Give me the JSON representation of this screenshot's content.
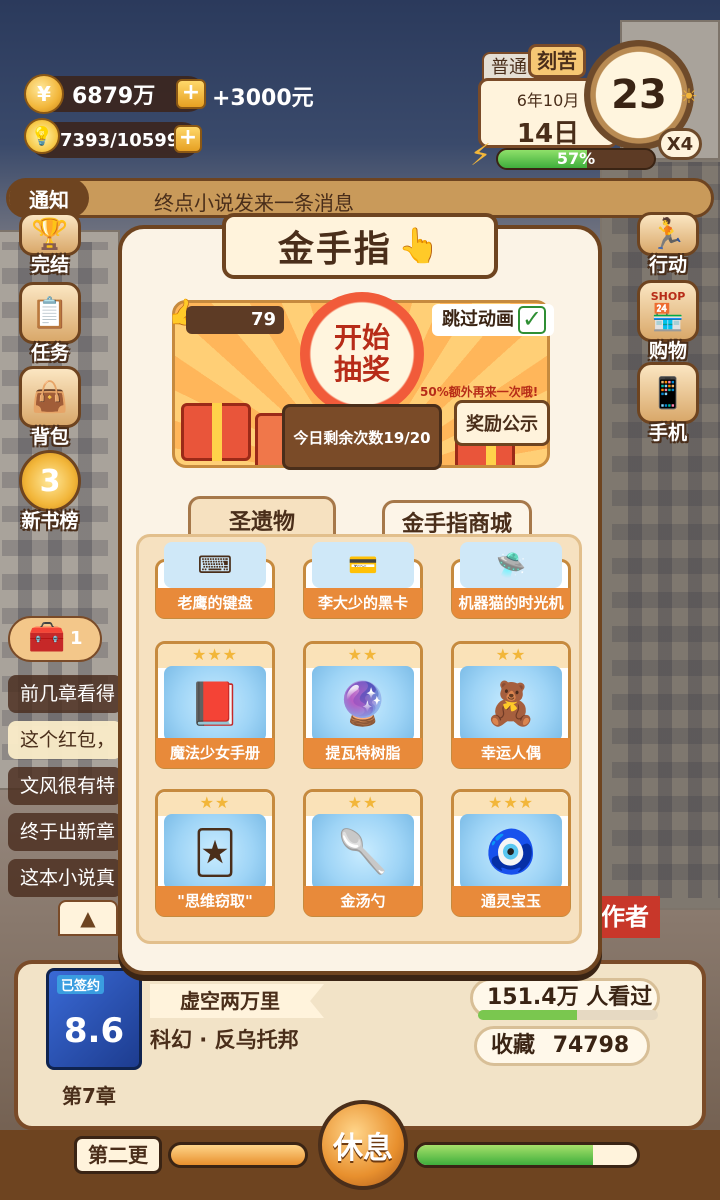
{
  "hud": {
    "money": "6879万",
    "money_bonus": "+3000元",
    "coin_symbol": "¥",
    "ideas": "7393/10599",
    "mode_normal": "普通",
    "mode_hard": "刻苦",
    "month": "6年10月",
    "day": "14日",
    "clock_value": "23",
    "speed": "X4",
    "energy_percent": "57%",
    "energy_fraction": 0.57
  },
  "notice": {
    "tag": "通知",
    "text": "终点小说发来一条消息"
  },
  "left_menu": [
    {
      "label": "完结",
      "icon": "trophy-icon"
    },
    {
      "label": "任务",
      "icon": "checklist-icon"
    },
    {
      "label": "背包",
      "icon": "bag-icon"
    },
    {
      "label": "新书榜",
      "icon": "medal-icon",
      "glyph": "3"
    }
  ],
  "right_menu": [
    {
      "label": "行动",
      "icon": "action-icon"
    },
    {
      "label": "购物",
      "icon": "shop-icon",
      "tag": "SHOP"
    },
    {
      "label": "手机",
      "icon": "phone-icon"
    }
  ],
  "treasure_count": "1",
  "chat_lines": [
    {
      "text": "前几章看得"
    },
    {
      "text": "这个红包，"
    },
    {
      "text": "文风很有特"
    },
    {
      "text": "终于出新章"
    },
    {
      "text": "这本小说真"
    }
  ],
  "author_tag": "作者",
  "modal": {
    "title": "金手指",
    "score": "79",
    "draw_button": "开始抽奖",
    "skip_label": "跳过动画",
    "skip_checked": true,
    "bonus_note": "50%额外再来一次哦!",
    "remaining": "今日剩余次数19/20",
    "reward_button": "奖励公示",
    "tabs": [
      {
        "label": "圣遗物",
        "active": true
      },
      {
        "label": "金手指商城",
        "active": false
      }
    ],
    "items_top": [
      {
        "label": "老鹰的键盘"
      },
      {
        "label": "李大少的黑卡"
      },
      {
        "label": "机器猫的时光机"
      }
    ],
    "items": [
      {
        "label": "魔法少女手册",
        "stars": "★★★",
        "icon": "book-icon",
        "glyph": "📕"
      },
      {
        "label": "提瓦特树脂",
        "stars": "★★",
        "icon": "resin-icon",
        "glyph": "🔮"
      },
      {
        "label": "幸运人偶",
        "stars": "★★",
        "icon": "doll-icon",
        "glyph": "🧸"
      },
      {
        "label": "\"思维窃取\"",
        "stars": "★★",
        "icon": "card-icon",
        "glyph": "🃏"
      },
      {
        "label": "金汤勺",
        "stars": "★★",
        "icon": "spoon-icon",
        "glyph": "🥄"
      },
      {
        "label": "通灵宝玉",
        "stars": "★★★",
        "icon": "jade-icon",
        "glyph": "🧿"
      }
    ]
  },
  "book": {
    "status_tag": "已签约",
    "rating": "8.6",
    "title": "虚空两万里",
    "genre": "科幻 · 反乌托邦",
    "chapter": "第7章",
    "views": "151.4万 人看过",
    "views_fraction": 0.55,
    "favorites_label": "收藏",
    "favorites": "74798"
  },
  "bottom": {
    "update_label": "第二更",
    "rest_label": "休息",
    "left_progress": 1.0,
    "right_progress": 0.8
  },
  "colors": {
    "accent_orange": "#e88a3a",
    "frame_brown": "#6e4420",
    "energy_green": "#3fae3c"
  }
}
